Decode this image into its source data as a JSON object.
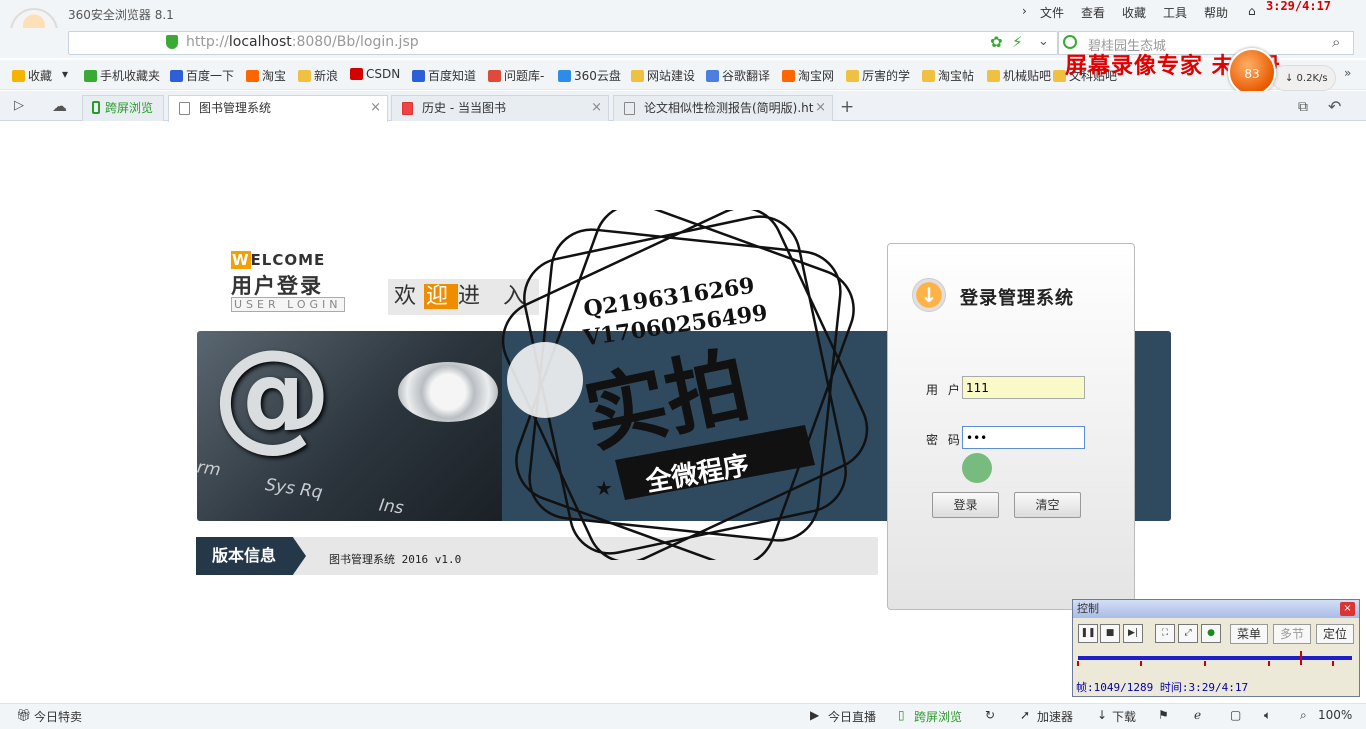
{
  "browser": {
    "title": "360安全浏览器 8.1",
    "menu": [
      "文件",
      "查看",
      "收藏",
      "工具",
      "帮助"
    ],
    "clock": "3:29/4:17",
    "url_prefix": "http://",
    "url_host": "localhost",
    "url_rest": ":8080/Bb/login.jsp",
    "search_placeholder": "碧桂园生态城",
    "recorder_watermark": "屏幕录像专家 未注册",
    "speed_ball": "83",
    "speed": "↓ 0.2K/s"
  },
  "bookmarks": [
    {
      "label": "收藏",
      "icon": "star-icon",
      "color": "#f5b400"
    },
    {
      "label": "手机收藏夹",
      "icon": "phone-icon",
      "color": "#3aaa35"
    },
    {
      "label": "百度一下",
      "icon": "baidu-icon",
      "color": "#2f5fd6"
    },
    {
      "label": "淘宝",
      "icon": "taobao-icon",
      "color": "#ff6600"
    },
    {
      "label": "新浪",
      "icon": "folder-icon",
      "color": "#f0c040"
    },
    {
      "label": "CSDN",
      "icon": "csdn-icon",
      "color": "#d40000"
    },
    {
      "label": "百度知道",
      "icon": "baidu-icon",
      "color": "#2f5fd6"
    },
    {
      "label": "问题库-",
      "icon": "s-icon",
      "color": "#e04a3a"
    },
    {
      "label": "360云盘",
      "icon": "cloud-icon",
      "color": "#2d8ce6"
    },
    {
      "label": "网站建设",
      "icon": "folder-icon",
      "color": "#f0c040"
    },
    {
      "label": "谷歌翻译",
      "icon": "translate-icon",
      "color": "#4a7fe0"
    },
    {
      "label": "淘宝网",
      "icon": "taobao-icon",
      "color": "#ff6600"
    },
    {
      "label": "厉害的学",
      "icon": "folder-icon",
      "color": "#f0c040"
    },
    {
      "label": "淘宝帖",
      "icon": "folder-icon",
      "color": "#f0c040"
    },
    {
      "label": "机械贴吧",
      "icon": "folder-icon",
      "color": "#f0c040"
    },
    {
      "label": "文科贴吧",
      "icon": "folder-icon",
      "color": "#f0c040"
    }
  ],
  "tabs": [
    {
      "label": "跨屏浏览"
    },
    {
      "label": "图书管理系统"
    },
    {
      "label": "历史 - 当当图书"
    },
    {
      "label": "论文相似性检测报告(简明版).ht"
    }
  ],
  "page": {
    "welcome_first": "W",
    "welcome_rest": "ELCOME",
    "user_login_cn": "用户登录",
    "user_login_en": "USER LOGIN",
    "welcome_enter_pre": "欢",
    "welcome_enter_hl": "迎",
    "welcome_enter_post": "进 入",
    "version_label": "版本信息",
    "version_text": "图书管理系统 2016 v1.0",
    "keys": [
      "Sys Rq",
      "Ins",
      "rm"
    ]
  },
  "login": {
    "title": "登录管理系统",
    "user_label": "用 户",
    "pass_label": "密 码",
    "username": "111",
    "password": "•••",
    "login_btn": "登录",
    "clear_btn": "清空"
  },
  "stamp": {
    "line1": "Q2196316269",
    "line2": "V17060256499",
    "big": "实拍",
    "banner": "全微程序"
  },
  "control": {
    "title": "控制",
    "menu": "菜单",
    "multi": "多节",
    "locate": "定位",
    "info": "帧:1049/1289 时间:3:29/4:17",
    "progress": 0.812
  },
  "status": {
    "left": "今日特卖",
    "items": [
      "今日直播",
      "跨屏浏览",
      "加速器",
      "下载"
    ],
    "zoom": "100%"
  }
}
